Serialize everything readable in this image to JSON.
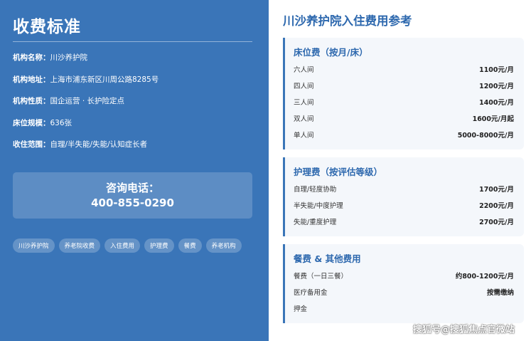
{
  "left": {
    "title": "收费标准",
    "info": [
      {
        "key": "机构名称：",
        "value": "川沙养护院"
      },
      {
        "key": "机构地址：",
        "value": "上海市浦东新区川周公路8285号"
      },
      {
        "key": "机构性质：",
        "value": "国企运营 · 长护险定点"
      },
      {
        "key": "床位规模：",
        "value": "636张"
      },
      {
        "key": "收住范围：",
        "value": "自理/半失能/失能/认知症长者"
      }
    ],
    "phone_label": "咨询电话：",
    "phone_number": "400-855-0290",
    "tags": [
      "川沙养护院",
      "养老院收费",
      "入住费用",
      "护理费",
      "餐费",
      "养老机构"
    ]
  },
  "right": {
    "title": "川沙养护院入住费用参考",
    "cards": [
      {
        "title": "床位费（按月/床）",
        "rows": [
          {
            "label": "六人间",
            "value": "1100元/月"
          },
          {
            "label": "四人间",
            "value": "1200元/月"
          },
          {
            "label": "三人间",
            "value": "1400元/月"
          },
          {
            "label": "双人间",
            "value": "1600元/月起"
          },
          {
            "label": "单人间",
            "value": "5000-8000元/月"
          }
        ]
      },
      {
        "title": "护理费（按评估等级）",
        "rows": [
          {
            "label": "自理/轻度协助",
            "value": "1700元/月"
          },
          {
            "label": "半失能/中度护理",
            "value": "2200元/月"
          },
          {
            "label": "失能/重度护理",
            "value": "2700元/月"
          }
        ]
      },
      {
        "title": "餐费 & 其他费用",
        "rows": [
          {
            "label": "餐费（一日三餐）",
            "value": "约800-1200元/月"
          },
          {
            "label": "医疗备用金",
            "value": "按需缴纳"
          },
          {
            "label": "押金",
            "value": ""
          }
        ]
      }
    ]
  },
  "watermark": "搜狐号@搜狐焦点官微站"
}
